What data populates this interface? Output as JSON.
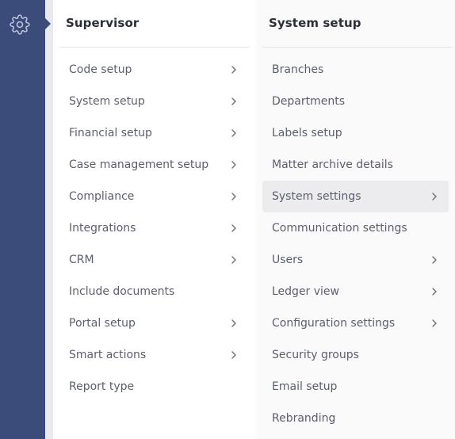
{
  "sidebar": {
    "settings_icon": "gear-icon"
  },
  "supervisor_panel": {
    "title": "Supervisor",
    "items": [
      {
        "label": "Code setup",
        "has_submenu": true
      },
      {
        "label": "System setup",
        "has_submenu": true
      },
      {
        "label": "Financial setup",
        "has_submenu": true
      },
      {
        "label": "Case management setup",
        "has_submenu": true
      },
      {
        "label": "Compliance",
        "has_submenu": true
      },
      {
        "label": "Integrations",
        "has_submenu": true
      },
      {
        "label": "CRM",
        "has_submenu": true
      },
      {
        "label": "Include documents",
        "has_submenu": false
      },
      {
        "label": "Portal setup",
        "has_submenu": true
      },
      {
        "label": "Smart actions",
        "has_submenu": true
      },
      {
        "label": "Report type",
        "has_submenu": false
      }
    ]
  },
  "system_setup_panel": {
    "title": "System setup",
    "items": [
      {
        "label": "Branches",
        "has_submenu": false
      },
      {
        "label": "Departments",
        "has_submenu": false
      },
      {
        "label": "Labels setup",
        "has_submenu": false
      },
      {
        "label": "Matter archive details",
        "has_submenu": false
      },
      {
        "label": "System settings",
        "has_submenu": true,
        "active": true
      },
      {
        "label": "Communication settings",
        "has_submenu": false
      },
      {
        "label": "Users",
        "has_submenu": true
      },
      {
        "label": "Ledger view",
        "has_submenu": true
      },
      {
        "label": "Configuration settings",
        "has_submenu": true
      },
      {
        "label": "Security groups",
        "has_submenu": false
      },
      {
        "label": "Email setup",
        "has_submenu": false
      },
      {
        "label": "Rebranding",
        "has_submenu": false
      }
    ]
  },
  "colors": {
    "rail": "#3b4b7a",
    "active_row": "#ececee",
    "text": "#5a5f6b",
    "title": "#2b2f38"
  }
}
